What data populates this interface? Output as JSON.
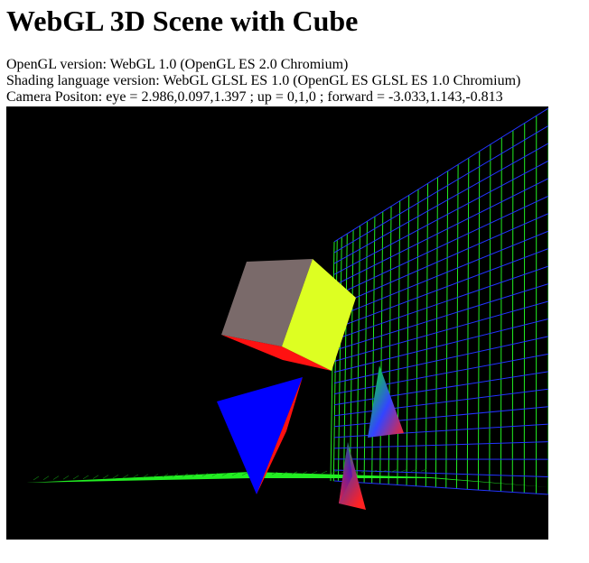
{
  "page": {
    "title": "WebGL 3D Scene with Cube"
  },
  "info": {
    "opengl_label": "OpenGL version:",
    "opengl_value": "WebGL 1.0 (OpenGL ES 2.0 Chromium)",
    "shading_label": "Shading language version:",
    "shading_value": "WebGL GLSL ES 1.0 (OpenGL ES GLSL ES 1.0 Chromium)",
    "camera_label": "Camera Positon:",
    "camera_value": "eye = 2.986,0.097,1.397 ; up = 0,1,0 ; forward = -3.033,1.143,-0.813"
  },
  "scene": {
    "background": "#000000",
    "grid_color_vertical": "#22ee22",
    "grid_color_horizontal": "#2233ff",
    "floor_color": "#22ee22",
    "cube_face_top": "#7a6a6a",
    "cube_face_side": "#ddff22",
    "cube_face_bottom": "#ff1111",
    "pyramid_colors": [
      "#0000ff",
      "#ff0000",
      "#00ff00"
    ]
  }
}
